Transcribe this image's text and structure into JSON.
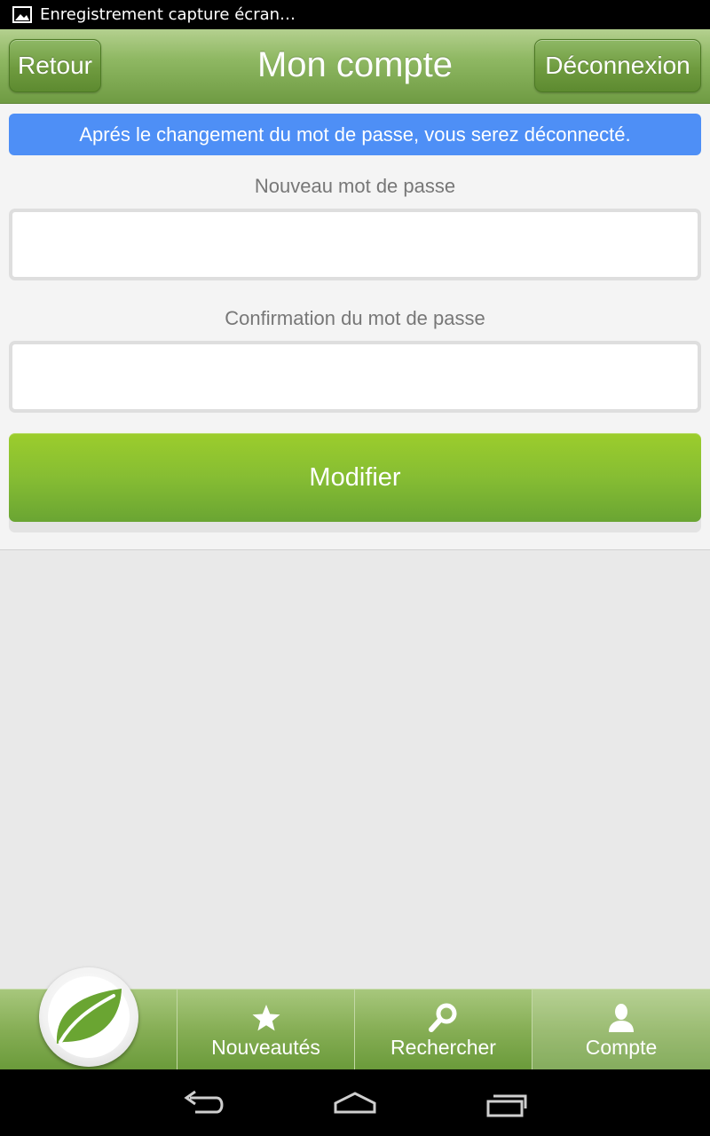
{
  "status_bar": {
    "notification_icon": "image-icon",
    "notification_text": "Enregistrement capture écran…"
  },
  "header": {
    "back_label": "Retour",
    "title": "Mon compte",
    "logout_label": "Déconnexion"
  },
  "form": {
    "info_message": "Aprés le changement du mot de passe, vous serez déconnecté.",
    "new_password_label": "Nouveau mot de passe",
    "new_password_value": "",
    "confirm_password_label": "Confirmation du mot de passe",
    "confirm_password_value": "",
    "submit_label": "Modifier"
  },
  "tabbar": {
    "logo_icon": "leaf-icon",
    "tabs": [
      {
        "label": "Nouveautés",
        "icon": "star-icon"
      },
      {
        "label": "Rechercher",
        "icon": "search-icon"
      },
      {
        "label": "Compte",
        "icon": "user-icon",
        "active": true
      }
    ]
  },
  "navbar": {
    "keys": [
      "back-icon",
      "home-icon",
      "recent-apps-icon"
    ]
  },
  "colors": {
    "header_green": "#7ea750",
    "banner_blue": "#4e8ff6",
    "button_green": "#86bd33"
  }
}
